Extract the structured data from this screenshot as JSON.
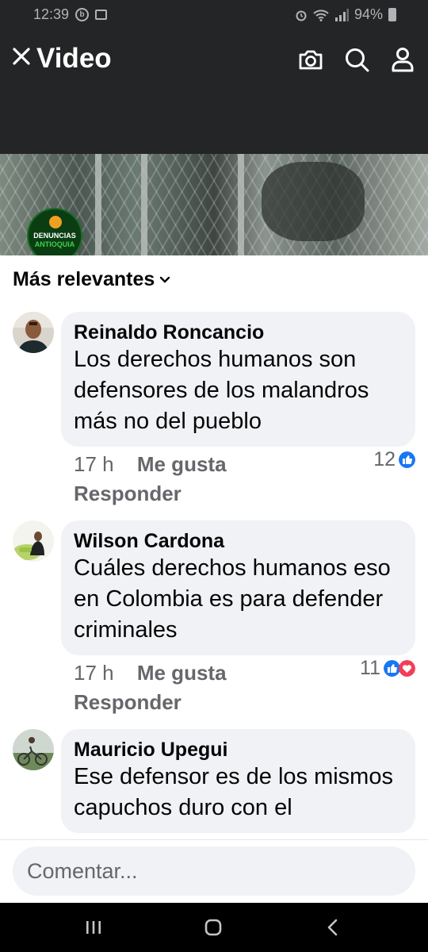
{
  "status_bar": {
    "time": "12:39",
    "battery": "94%"
  },
  "header": {
    "title": "Video",
    "icons": [
      "close-icon",
      "camera-icon",
      "search-icon",
      "profile-icon"
    ]
  },
  "video": {
    "logo_line1": "DENUNCIAS",
    "logo_line2": "ANTIOQUIA"
  },
  "sort": {
    "label": "Más relevantes"
  },
  "comments": [
    {
      "author": "Reinaldo Roncancio",
      "text": "Los derechos humanos son defensores de los malandros más no del pueblo",
      "time": "17 h",
      "like_label": "Me gusta",
      "reply_label": "Responder",
      "reaction_count": "12",
      "reactions": [
        "like-icon"
      ]
    },
    {
      "author": "Wilson Cardona",
      "text": "Cuáles derechos humanos eso en Colombia es para defender criminales",
      "time": "17 h",
      "like_label": "Me gusta",
      "reply_label": "Responder",
      "reaction_count": "11",
      "reactions": [
        "like-icon",
        "love-icon"
      ]
    },
    {
      "author": "Mauricio Upegui",
      "text": "Ese defensor es de los mismos capuchos duro con el"
    }
  ],
  "comment_box": {
    "placeholder": "Comentar..."
  },
  "colors": {
    "header_bg": "#242526",
    "bubble_bg": "#f0f2f5",
    "like_blue": "#1877f2",
    "love_red": "#f33e58",
    "muted_text": "#65676b"
  }
}
